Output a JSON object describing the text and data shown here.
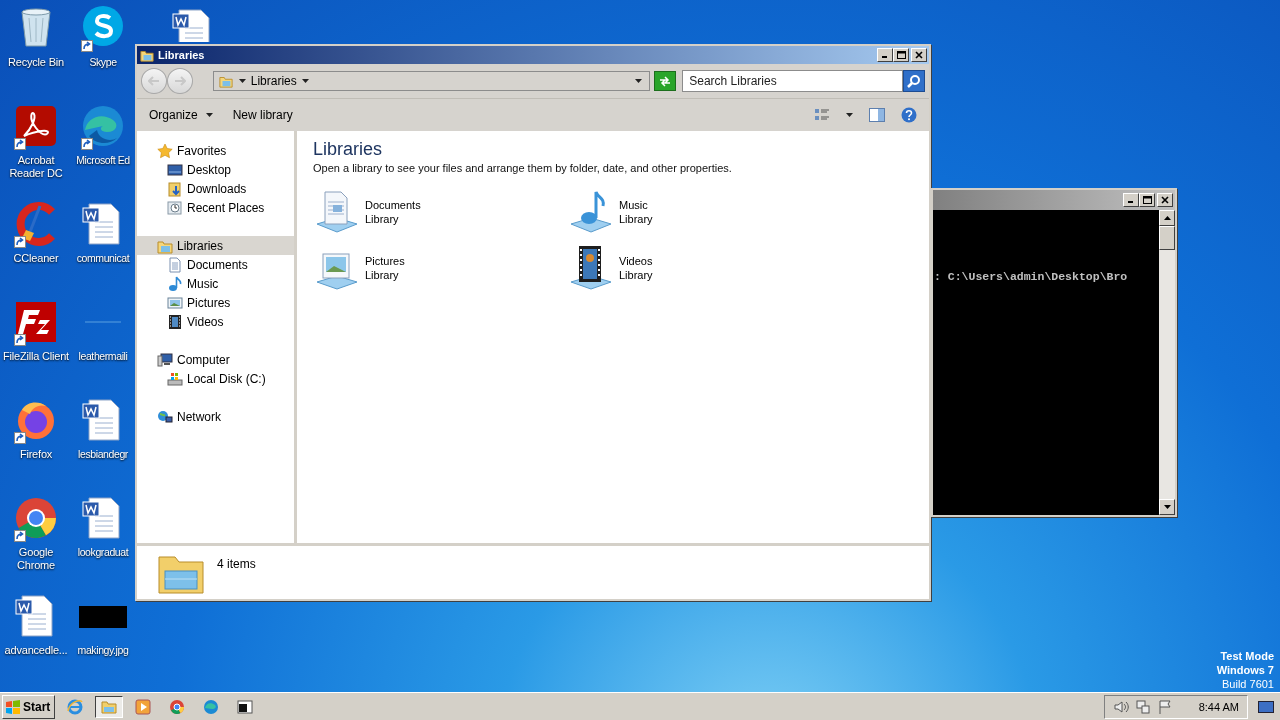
{
  "desktop_icons": [
    {
      "label": "Recycle Bin",
      "kind": "recycle",
      "shortcut": false
    },
    {
      "label": "Acrobat Reader DC",
      "kind": "acrobat",
      "shortcut": true
    },
    {
      "label": "CCleaner",
      "kind": "ccleaner",
      "shortcut": true
    },
    {
      "label": "FileZilla Client",
      "kind": "filezilla",
      "shortcut": true
    },
    {
      "label": "Firefox",
      "kind": "firefox",
      "shortcut": true
    },
    {
      "label": "Google Chrome",
      "kind": "chrome",
      "shortcut": true
    },
    {
      "label": "advancedle...",
      "kind": "word",
      "shortcut": false
    },
    {
      "label": "Skype",
      "kind": "skype",
      "shortcut": true
    },
    {
      "label": "Microsoft Ed",
      "kind": "edge",
      "shortcut": true
    },
    {
      "label": "communicat",
      "kind": "word",
      "shortcut": false
    },
    {
      "label": "leathermaili",
      "kind": "blank",
      "shortcut": false
    },
    {
      "label": "lesbiandegr",
      "kind": "word",
      "shortcut": false
    },
    {
      "label": "lookgraduat",
      "kind": "word",
      "shortcut": false
    },
    {
      "label": "makingy.jpg",
      "kind": "image",
      "shortcut": false
    },
    {
      "kind": "word",
      "shortcut": false
    }
  ],
  "explorer": {
    "title": "Libraries",
    "address": {
      "crumbs": [
        "Libraries"
      ]
    },
    "search": {
      "placeholder": "Search Libraries"
    },
    "toolbar": [
      {
        "label": "Organize",
        "dropdown": true
      },
      {
        "label": "New library",
        "dropdown": false
      }
    ],
    "nav_tree": [
      {
        "label": "Favorites",
        "kind": "star",
        "selected": false,
        "children": [
          {
            "label": "Desktop",
            "kind": "desktop",
            "selected": false
          },
          {
            "label": "Downloads",
            "kind": "downloads",
            "selected": false
          },
          {
            "label": "Recent Places",
            "kind": "recent",
            "selected": false
          }
        ]
      },
      {
        "label": "Libraries",
        "kind": "libraries",
        "selected": true,
        "children": [
          {
            "label": "Documents",
            "kind": "documents",
            "selected": false
          },
          {
            "label": "Music",
            "kind": "music",
            "selected": false
          },
          {
            "label": "Pictures",
            "kind": "pictures",
            "selected": false
          },
          {
            "label": "Videos",
            "kind": "videos",
            "selected": false
          }
        ]
      },
      {
        "label": "Computer",
        "kind": "computer",
        "selected": false,
        "children": [
          {
            "label": "Local Disk (C:)",
            "kind": "disk",
            "selected": false
          }
        ]
      },
      {
        "label": "Network",
        "kind": "network",
        "selected": false
      }
    ],
    "heading": "Libraries",
    "description": "Open a library to see your files and arrange them by folder, date, and other properties.",
    "libraries": [
      {
        "name": "Documents",
        "type": "Library",
        "kind": "documents"
      },
      {
        "name": "Music",
        "type": "Library",
        "kind": "music"
      },
      {
        "name": "Pictures",
        "type": "Library",
        "kind": "pictures"
      },
      {
        "name": "Videos",
        "type": "Library",
        "kind": "videos"
      }
    ],
    "details": {
      "count": "4 items"
    }
  },
  "console": {
    "line": ": C:\\Users\\admin\\Desktop\\Bro"
  },
  "desktop_notice": [
    "Test Mode",
    "Windows 7",
    "Build 7601"
  ],
  "taskbar": {
    "start": "Start",
    "apps": [
      {
        "kind": "ie",
        "active": false
      },
      {
        "kind": "explorer",
        "active": true
      },
      {
        "kind": "media",
        "active": false
      },
      {
        "kind": "chrome",
        "active": false
      },
      {
        "kind": "edge",
        "active": false
      },
      {
        "kind": "console",
        "active": false
      }
    ],
    "clock": "8:44 AM"
  }
}
